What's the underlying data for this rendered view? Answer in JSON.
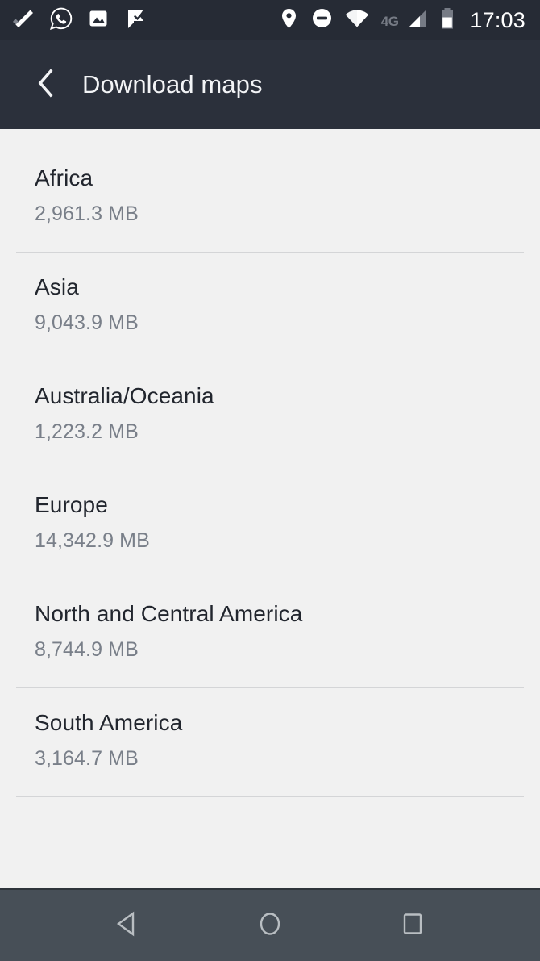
{
  "status_bar": {
    "background_color": "#262b35",
    "left_icons": [
      {
        "name": "tasks-check-icon",
        "label": "check"
      },
      {
        "name": "whatsapp-icon",
        "label": "WhatsApp"
      },
      {
        "name": "photo-icon",
        "label": "photo"
      },
      {
        "name": "flag-check-icon",
        "label": "flag"
      }
    ],
    "right_icons": [
      {
        "name": "location-pin-icon",
        "label": "location"
      },
      {
        "name": "do-not-disturb-icon",
        "label": "do not disturb"
      },
      {
        "name": "wifi-icon",
        "label": "wifi"
      }
    ],
    "network_type": "4G",
    "signal": "signal-bars-icon",
    "battery": "battery-icon",
    "time": "17:03"
  },
  "app_bar": {
    "background_color": "#2b303b",
    "back_icon": "back-chevron-icon",
    "title": "Download maps"
  },
  "list": {
    "background_color": "#f1f1f1",
    "title_color": "#22262e",
    "size_color": "#797f89",
    "divider_color": "#d4d5d7",
    "items": [
      {
        "name": "Africa",
        "size": "2,961.3 MB"
      },
      {
        "name": "Asia",
        "size": "9,043.9 MB"
      },
      {
        "name": "Australia/Oceania",
        "size": "1,223.2 MB"
      },
      {
        "name": "Europe",
        "size": "14,342.9 MB"
      },
      {
        "name": "North and Central America",
        "size": "8,744.9 MB"
      },
      {
        "name": "South America",
        "size": "3,164.7 MB"
      }
    ]
  },
  "nav_bar": {
    "background_color": "#474f57",
    "buttons": [
      {
        "name": "back-triangle-icon",
        "label": "Back"
      },
      {
        "name": "home-circle-icon",
        "label": "Home"
      },
      {
        "name": "recents-square-icon",
        "label": "Recents"
      }
    ]
  }
}
